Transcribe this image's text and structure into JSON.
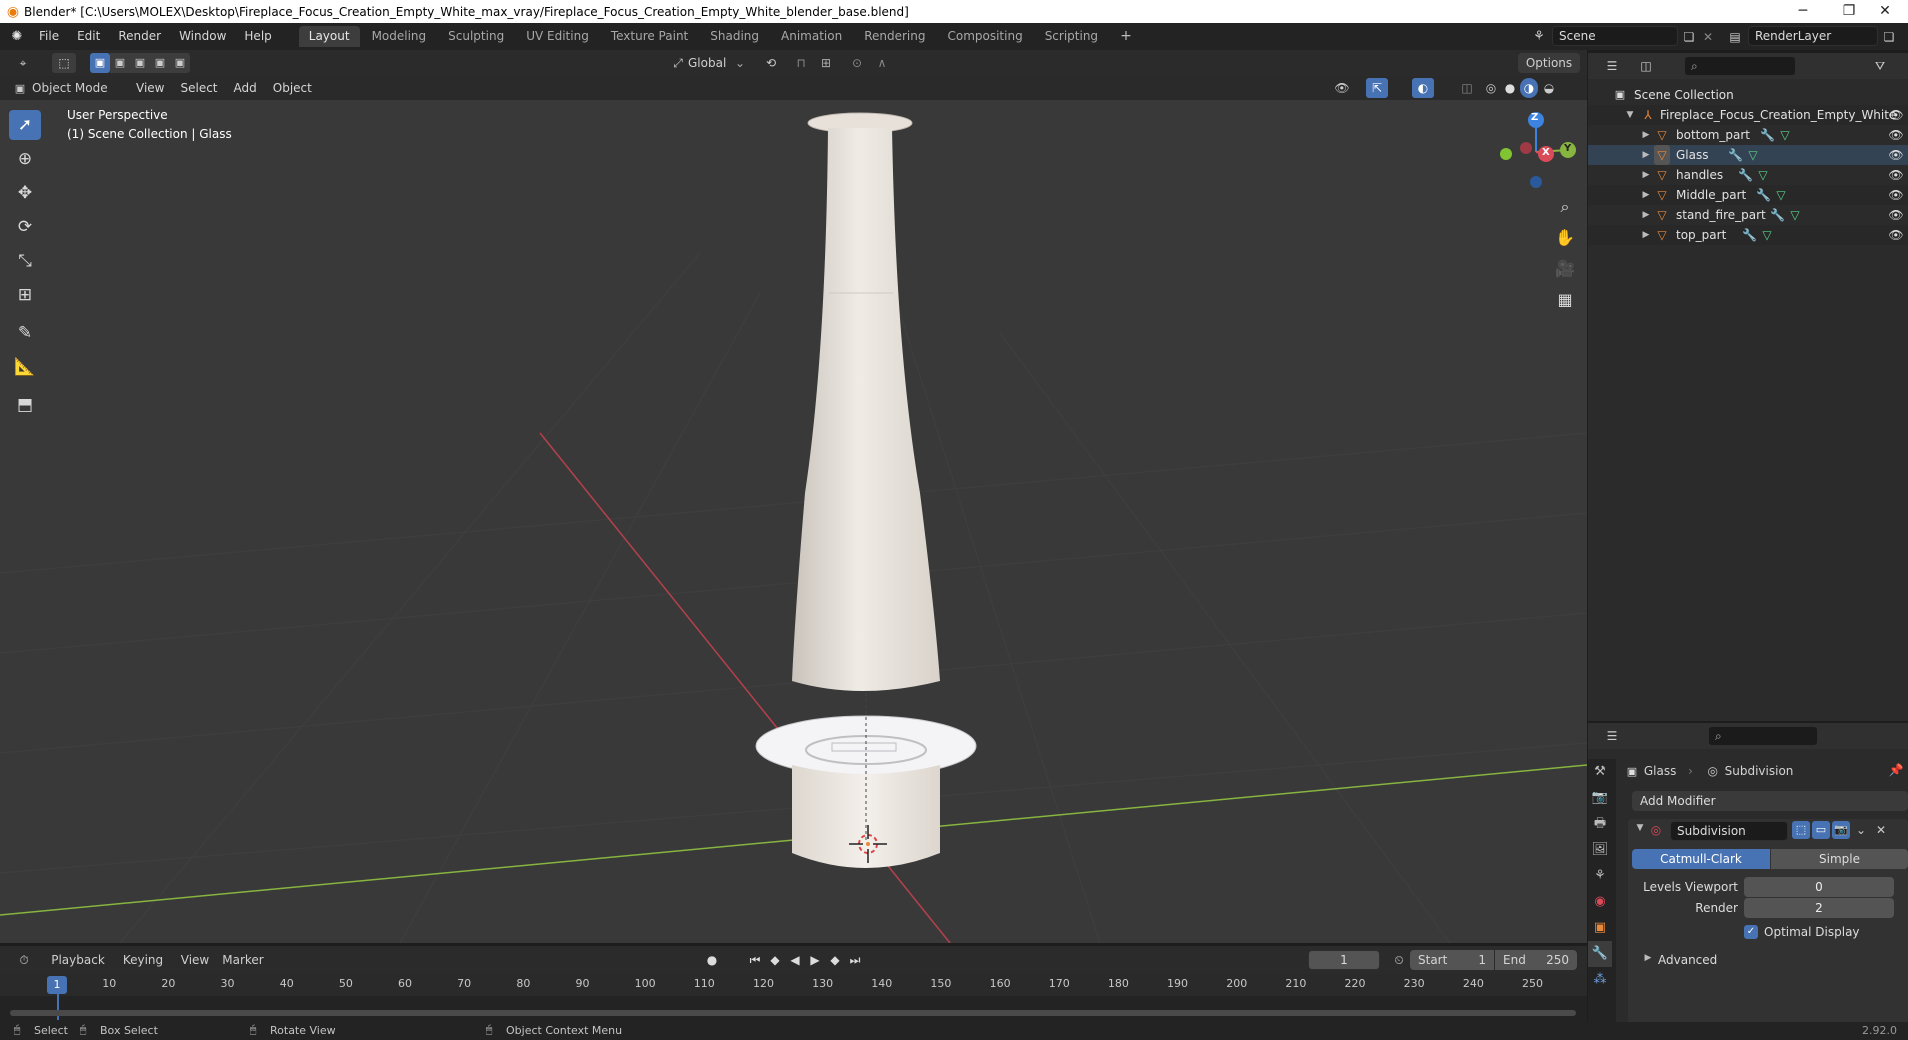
{
  "window": {
    "title": "Blender* [C:\\Users\\MOLEX\\Desktop\\Fireplace_Focus_Creation_Empty_White_max_vray/Fireplace_Focus_Creation_Empty_White_blender_base.blend]",
    "min_glyph": "─",
    "max_glyph": "❐",
    "close_glyph": "✕"
  },
  "menu": {
    "items": [
      "File",
      "Edit",
      "Render",
      "Window",
      "Help"
    ],
    "workspaces": [
      "Layout",
      "Modeling",
      "Sculpting",
      "UV Editing",
      "Texture Paint",
      "Shading",
      "Animation",
      "Rendering",
      "Compositing",
      "Scripting"
    ],
    "active_workspace": "Layout",
    "add_tab": "+",
    "scene_value": "Scene",
    "view_layer_value": "RenderLayer"
  },
  "tool_header": {
    "orientation": "Global",
    "options_label": "Options"
  },
  "viewport_header": {
    "mode": "Object Mode",
    "menus": [
      "View",
      "Select",
      "Add",
      "Object"
    ]
  },
  "viewport": {
    "perspective_label": "User Perspective",
    "collection_label": "(1) Scene Collection | Glass",
    "gizmo": {
      "z": "Z",
      "x": "X",
      "y": "Y"
    }
  },
  "outliner": {
    "root": "Scene Collection",
    "collection": "Fireplace_Focus_Creation_Empty_White",
    "objects": [
      "bottom_part",
      "Glass",
      "handles",
      "Middle_part",
      "stand_fire_part",
      "top_part"
    ],
    "selected": "Glass"
  },
  "properties": {
    "object_name": "Glass",
    "modifier_breadcrumb": "Subdivision",
    "add_modifier": "Add Modifier",
    "modifier_name": "Subdivision",
    "type_options": [
      "Catmull-Clark",
      "Simple"
    ],
    "active_type": "Catmull-Clark",
    "levels_viewport_label": "Levels Viewport",
    "levels_viewport_value": "0",
    "render_label": "Render",
    "render_value": "2",
    "optimal_display_label": "Optimal Display",
    "optimal_display_checked": true,
    "advanced_label": "Advanced"
  },
  "timeline": {
    "menus": [
      "Playback",
      "Keying",
      "View",
      "Marker"
    ],
    "current_frame": "1",
    "start_label": "Start",
    "start_value": "1",
    "end_label": "End",
    "end_value": "250",
    "ticks": [
      "1",
      "10",
      "20",
      "30",
      "40",
      "50",
      "60",
      "70",
      "80",
      "90",
      "100",
      "110",
      "120",
      "130",
      "140",
      "150",
      "160",
      "170",
      "180",
      "190",
      "200",
      "210",
      "220",
      "230",
      "240",
      "250"
    ]
  },
  "status": {
    "select": "Select",
    "box_select": "Box Select",
    "rotate_view": "Rotate View",
    "context_menu": "Object Context Menu",
    "version": "2.92.0"
  },
  "colors": {
    "accent": "#4772b3",
    "viewport_bg": "#393939",
    "panel_bg": "#2b2b2b",
    "x_axis": "#d94b59",
    "y_axis": "#87b53f",
    "z_axis": "#3d84e0",
    "object_orange": "#e8883a"
  }
}
